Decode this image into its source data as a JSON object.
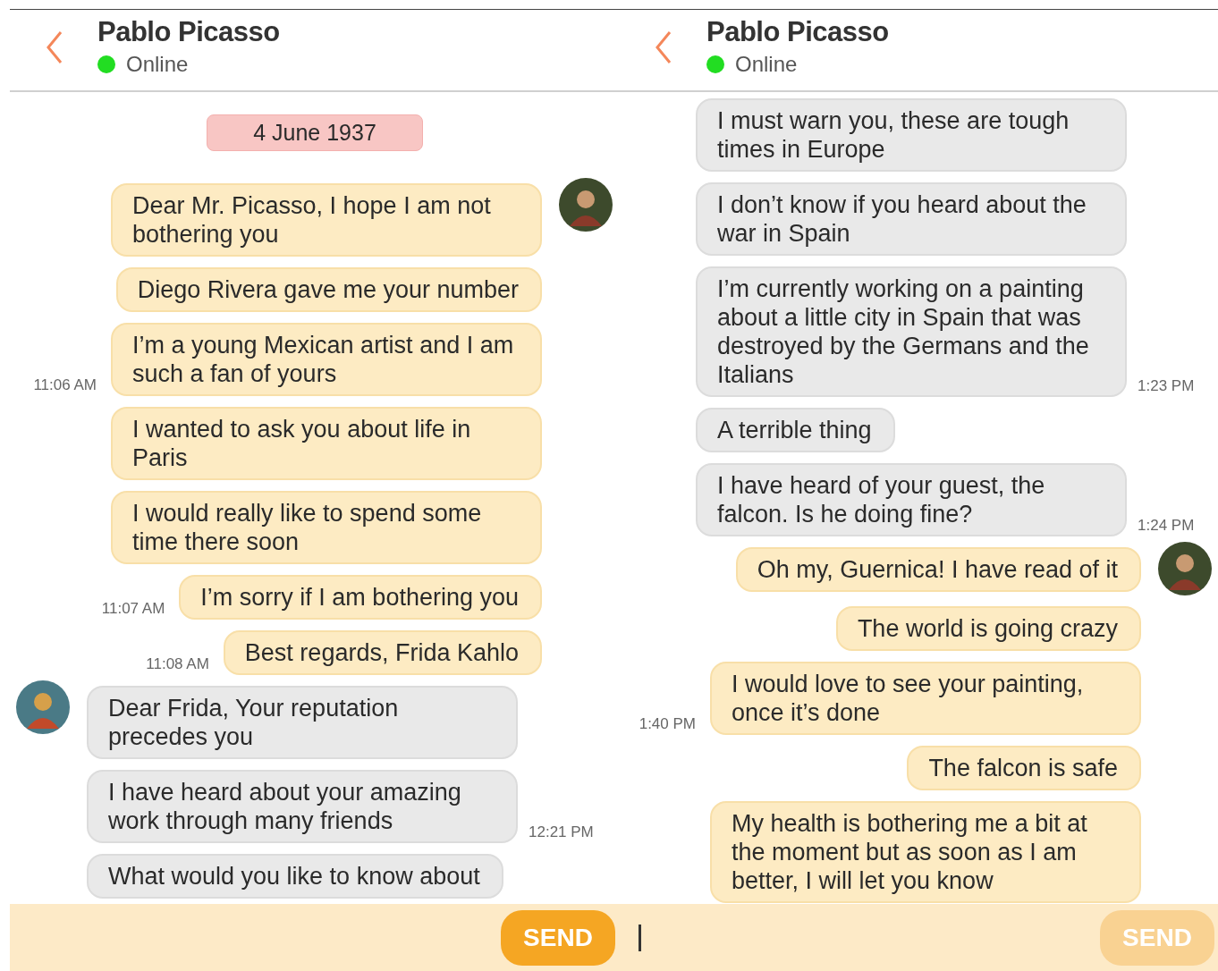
{
  "panels": [
    {
      "header": {
        "title": "Pablo Picasso",
        "status": "Online",
        "online": true
      },
      "messages": [
        {
          "kind": "date",
          "text": "4 June 1937"
        },
        {
          "kind": "sent",
          "avatar": true,
          "text": "Dear Mr. Picasso, I hope I am not bothering you"
        },
        {
          "kind": "sent",
          "avatar": false,
          "text": "Diego Rivera gave me your number"
        },
        {
          "kind": "sent",
          "avatar": false,
          "text": "I’m a young Mexican artist and I am such a fan of yours",
          "time": "11:06 AM"
        },
        {
          "kind": "sent",
          "avatar": false,
          "text": "I wanted to ask you about life in Paris"
        },
        {
          "kind": "sent",
          "avatar": false,
          "text": "I would really like to spend some time there soon"
        },
        {
          "kind": "sent",
          "avatar": false,
          "text": "I’m sorry if I am bothering you",
          "time": "11:07 AM"
        },
        {
          "kind": "sent",
          "avatar": false,
          "text": "Best regards, Frida Kahlo",
          "time": "11:08 AM"
        },
        {
          "kind": "received",
          "avatar": true,
          "text": "Dear Frida, Your reputation precedes you"
        },
        {
          "kind": "received",
          "avatar": false,
          "text": "I have heard about your amazing work through many friends",
          "time": "12:21 PM"
        },
        {
          "kind": "received",
          "avatar": false,
          "text": "What would you like to know about"
        }
      ],
      "send": {
        "label": "SEND",
        "disabled": false
      }
    },
    {
      "header": {
        "title": "Pablo Picasso",
        "status": "Online",
        "online": true
      },
      "messages": [
        {
          "kind": "received",
          "avatar": false,
          "text": "I must warn you, these are tough times in Europe"
        },
        {
          "kind": "received",
          "avatar": false,
          "text": "I don’t know if you heard about the war in Spain"
        },
        {
          "kind": "received",
          "avatar": false,
          "text": "I’m currently working on a painting about a little city in Spain that was destroyed by the Germans and the Italians",
          "time": "1:23 PM"
        },
        {
          "kind": "received",
          "avatar": false,
          "text": "A terrible thing"
        },
        {
          "kind": "received",
          "avatar": false,
          "text": "I have heard of your guest, the falcon. Is he doing fine?",
          "time": "1:24 PM"
        },
        {
          "kind": "sent",
          "avatar": true,
          "text": "Oh my, Guernica! I have read of it"
        },
        {
          "kind": "sent",
          "avatar": false,
          "text": "The world is going crazy"
        },
        {
          "kind": "sent",
          "avatar": false,
          "text": "I would love to see your painting, once it’s done",
          "time": "1:40 PM"
        },
        {
          "kind": "sent",
          "avatar": false,
          "text": "The falcon is safe"
        },
        {
          "kind": "sent",
          "avatar": false,
          "text": "My health is bothering me a bit at the moment but as soon as I am better, I will let you know"
        }
      ],
      "composer": {
        "focused": true
      },
      "send": {
        "label": "SEND",
        "disabled": true
      }
    }
  ]
}
